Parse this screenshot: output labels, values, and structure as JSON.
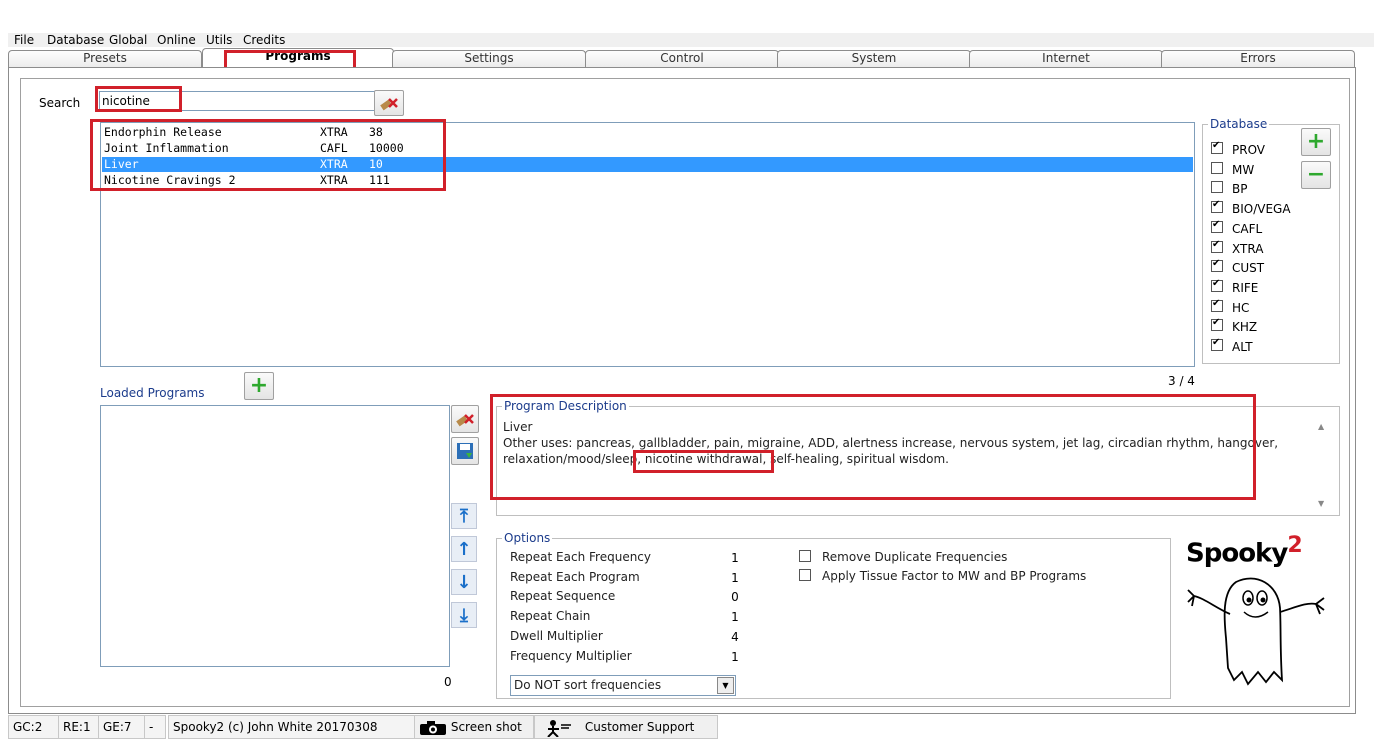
{
  "menu": [
    "File",
    "Database",
    "Global",
    "Online",
    "Utils",
    "Credits"
  ],
  "tabs": [
    "Presets",
    "Programs",
    "Settings",
    "Control",
    "System",
    "Internet",
    "Errors"
  ],
  "active_tab": "Programs",
  "search": {
    "label": "Search",
    "value": "nicotine"
  },
  "programs": [
    {
      "name": "Endorphin Release",
      "db": "XTRA",
      "num": "38",
      "selected": false
    },
    {
      "name": "Joint Inflammation",
      "db": "CAFL",
      "num": "10000",
      "selected": false
    },
    {
      "name": "Liver",
      "db": "XTRA",
      "num": "10",
      "selected": true
    },
    {
      "name": "Nicotine Cravings 2",
      "db": "XTRA",
      "num": "111",
      "selected": false
    }
  ],
  "database": {
    "title": "Database",
    "items": [
      {
        "label": "PROV",
        "checked": true
      },
      {
        "label": "MW",
        "checked": false
      },
      {
        "label": "BP",
        "checked": false
      },
      {
        "label": "BIO/VEGA",
        "checked": true
      },
      {
        "label": "CAFL",
        "checked": true
      },
      {
        "label": "XTRA",
        "checked": true
      },
      {
        "label": "CUST",
        "checked": true
      },
      {
        "label": "RIFE",
        "checked": true
      },
      {
        "label": "HC",
        "checked": true
      },
      {
        "label": "KHZ",
        "checked": true
      },
      {
        "label": "ALT",
        "checked": true
      }
    ]
  },
  "result_count": "3 / 4",
  "loaded_programs": {
    "label": "Loaded Programs",
    "count": "0"
  },
  "description": {
    "title": "Program Description",
    "line1": "Liver",
    "line2": "Other uses: pancreas, gallbladder, pain, migraine, ADD, alertness increase, nervous system, jet lag, circadian rhythm, hangover,",
    "line3a": "relaxation/mood/sleep, ",
    "line3b": "nicotine withdrawal",
    "line3c": ", self-healing, spiritual wisdom."
  },
  "options": {
    "title": "Options",
    "rows": [
      {
        "label": "Repeat Each Frequency",
        "value": "1"
      },
      {
        "label": "Repeat Each Program",
        "value": "1"
      },
      {
        "label": "Repeat Sequence",
        "value": "0"
      },
      {
        "label": "Repeat Chain",
        "value": "1"
      },
      {
        "label": "Dwell Multiplier",
        "value": "4"
      },
      {
        "label": "Frequency Multiplier",
        "value": "1"
      }
    ],
    "checkboxes": [
      {
        "label": "Remove Duplicate Frequencies",
        "checked": false
      },
      {
        "label": "Apply Tissue Factor to MW and BP Programs",
        "checked": false
      }
    ],
    "sort_select": "Do NOT sort frequencies"
  },
  "logo": {
    "text": "Spooky",
    "sup": "2"
  },
  "status": {
    "gc": "GC:2",
    "re": "RE:1",
    "ge": "GE:7",
    "dash": "-",
    "copyright": "Spooky2 (c) John White 20170308",
    "screenshot": "Screen shot",
    "support": "Customer Support"
  },
  "colors": {
    "highlight": "#d1202a",
    "selection": "#3399ff",
    "group_title": "#1c3c8c"
  }
}
